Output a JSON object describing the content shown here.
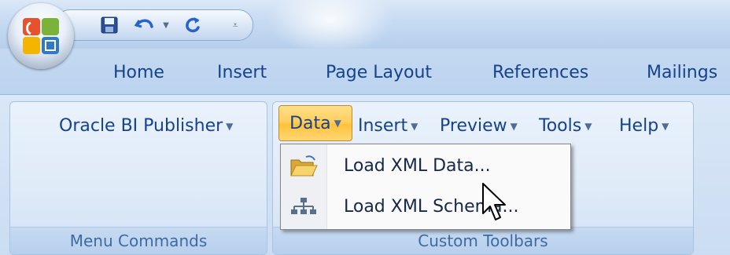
{
  "quick_access": {
    "buttons": [
      {
        "name": "save-icon"
      },
      {
        "name": "undo-icon"
      },
      {
        "name": "redo-icon"
      },
      {
        "name": "customize-qat-icon"
      }
    ]
  },
  "tabs": [
    {
      "label": "Home"
    },
    {
      "label": "Insert"
    },
    {
      "label": "Page Layout"
    },
    {
      "label": "References"
    },
    {
      "label": "Mailings"
    }
  ],
  "ribbon": {
    "groups": [
      {
        "label": "Menu Commands",
        "menus": [
          {
            "label": "Oracle BI Publisher"
          }
        ]
      },
      {
        "label": "Custom Toolbars",
        "menus": [
          {
            "label": "Data"
          },
          {
            "label": "Insert"
          },
          {
            "label": "Preview"
          },
          {
            "label": "Tools"
          },
          {
            "label": "Help"
          }
        ]
      }
    ]
  },
  "dropdown": {
    "items": [
      {
        "label": "Load XML Data...",
        "icon": "open-folder-icon"
      },
      {
        "label": "Load XML Schema...",
        "icon": "hierarchy-icon"
      }
    ]
  },
  "colors": {
    "tab_text": "#15428b",
    "group_label": "#3e6aa3",
    "highlight": "#ffcf5e"
  }
}
